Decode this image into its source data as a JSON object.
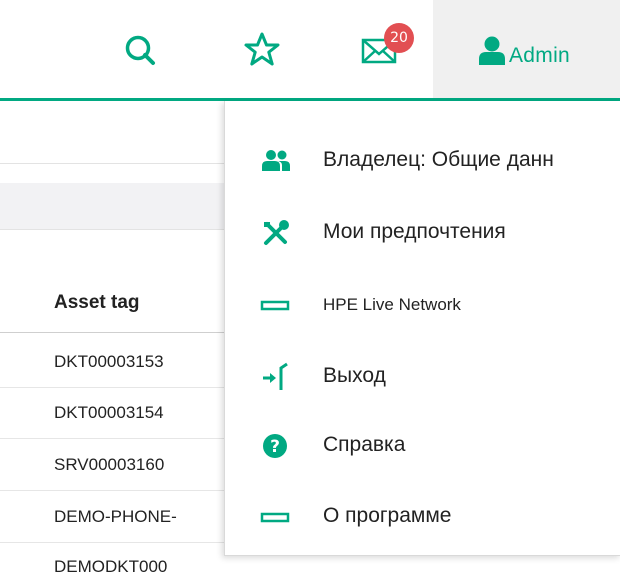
{
  "header": {
    "notification_count": "20",
    "user_label": "Admin"
  },
  "table": {
    "column_header": "Asset tag",
    "rows": [
      "DKT00003153",
      "DKT00003154",
      "SRV00003160",
      "DEMO-PHONE-",
      "DEMODKT000"
    ]
  },
  "user_menu": {
    "items": [
      {
        "label": "Владелец: Общие данн",
        "icon": "user-group-icon"
      },
      {
        "label": "Мои предпочтения",
        "icon": "tools-icon"
      },
      {
        "label": "HPE Live Network",
        "icon": "rectangle-icon"
      },
      {
        "label": "Выход",
        "icon": "logout-icon"
      },
      {
        "label": "Справка",
        "icon": "help-icon"
      },
      {
        "label": "О программе",
        "icon": "rectangle-icon"
      }
    ]
  },
  "colors": {
    "accent": "#01a982",
    "badge": "#e24f52"
  }
}
